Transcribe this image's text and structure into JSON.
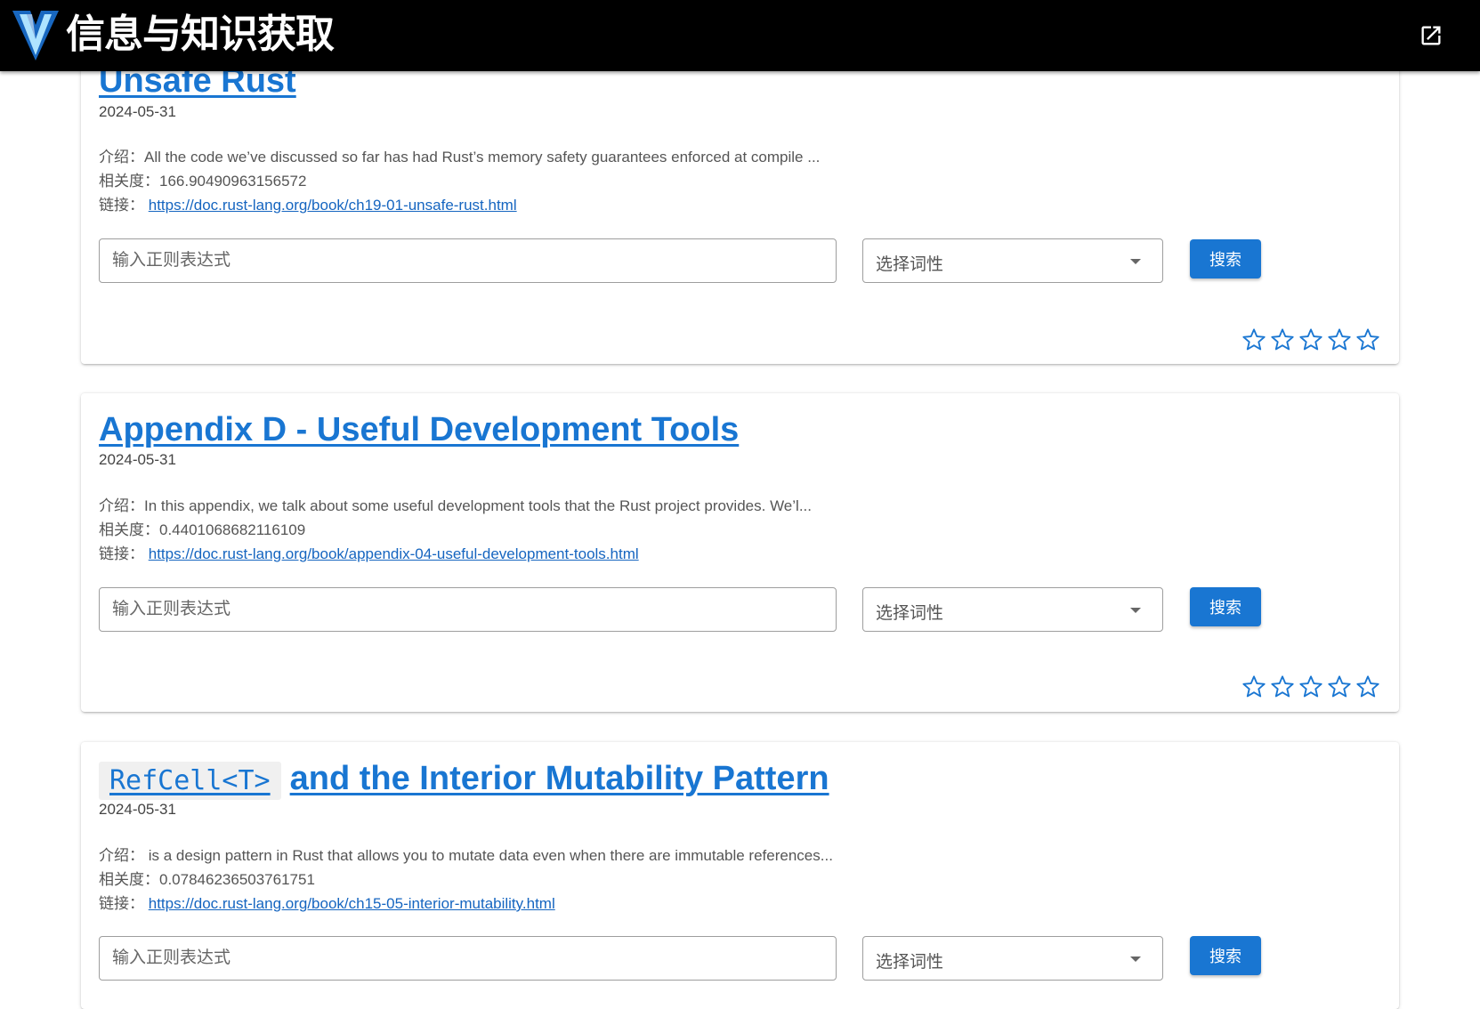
{
  "header": {
    "title": "信息与知识获取",
    "logo": "vuetify-v-logo",
    "action_icon": "open-in-new-icon"
  },
  "labels": {
    "intro_prefix": "介绍：",
    "relevance_prefix": "相关度：",
    "link_prefix": "链接："
  },
  "colors": {
    "accent": "#1976d2",
    "app_bar": "#000000",
    "star_outline": "#1976d2"
  },
  "results": [
    {
      "title_code": "",
      "title": "Unsafe Rust",
      "date": "2024-05-31",
      "intro": "All the code we’ve discussed so far has had Rust’s memory safety guarantees enforced at compile ...",
      "relevance": "166.90490963156572",
      "link": "https://doc.rust-lang.org/book/ch19-01-unsafe-rust.html",
      "regex_placeholder": "输入正则表达式",
      "pos_select": "选择词性",
      "search_label": "搜索",
      "rating": 0,
      "rating_max": 5
    },
    {
      "title_code": "",
      "title": "Appendix D - Useful Development Tools",
      "date": "2024-05-31",
      "intro": "In this appendix, we talk about some useful development tools that the Rust project provides. We’l...",
      "relevance": "0.4401068682116109",
      "link": "https://doc.rust-lang.org/book/appendix-04-useful-development-tools.html",
      "regex_placeholder": "输入正则表达式",
      "pos_select": "选择词性",
      "search_label": "搜索",
      "rating": 0,
      "rating_max": 5
    },
    {
      "title_code": "RefCell<T>",
      "title": "and the Interior Mutability Pattern",
      "date": "2024-05-31",
      "intro": " is a design pattern in Rust that allows you to mutate data even when there are immutable references...",
      "relevance": "0.07846236503761751",
      "link": "https://doc.rust-lang.org/book/ch15-05-interior-mutability.html",
      "regex_placeholder": "输入正则表达式",
      "pos_select": "选择词性",
      "search_label": "搜索",
      "rating": 0,
      "rating_max": 5
    }
  ]
}
